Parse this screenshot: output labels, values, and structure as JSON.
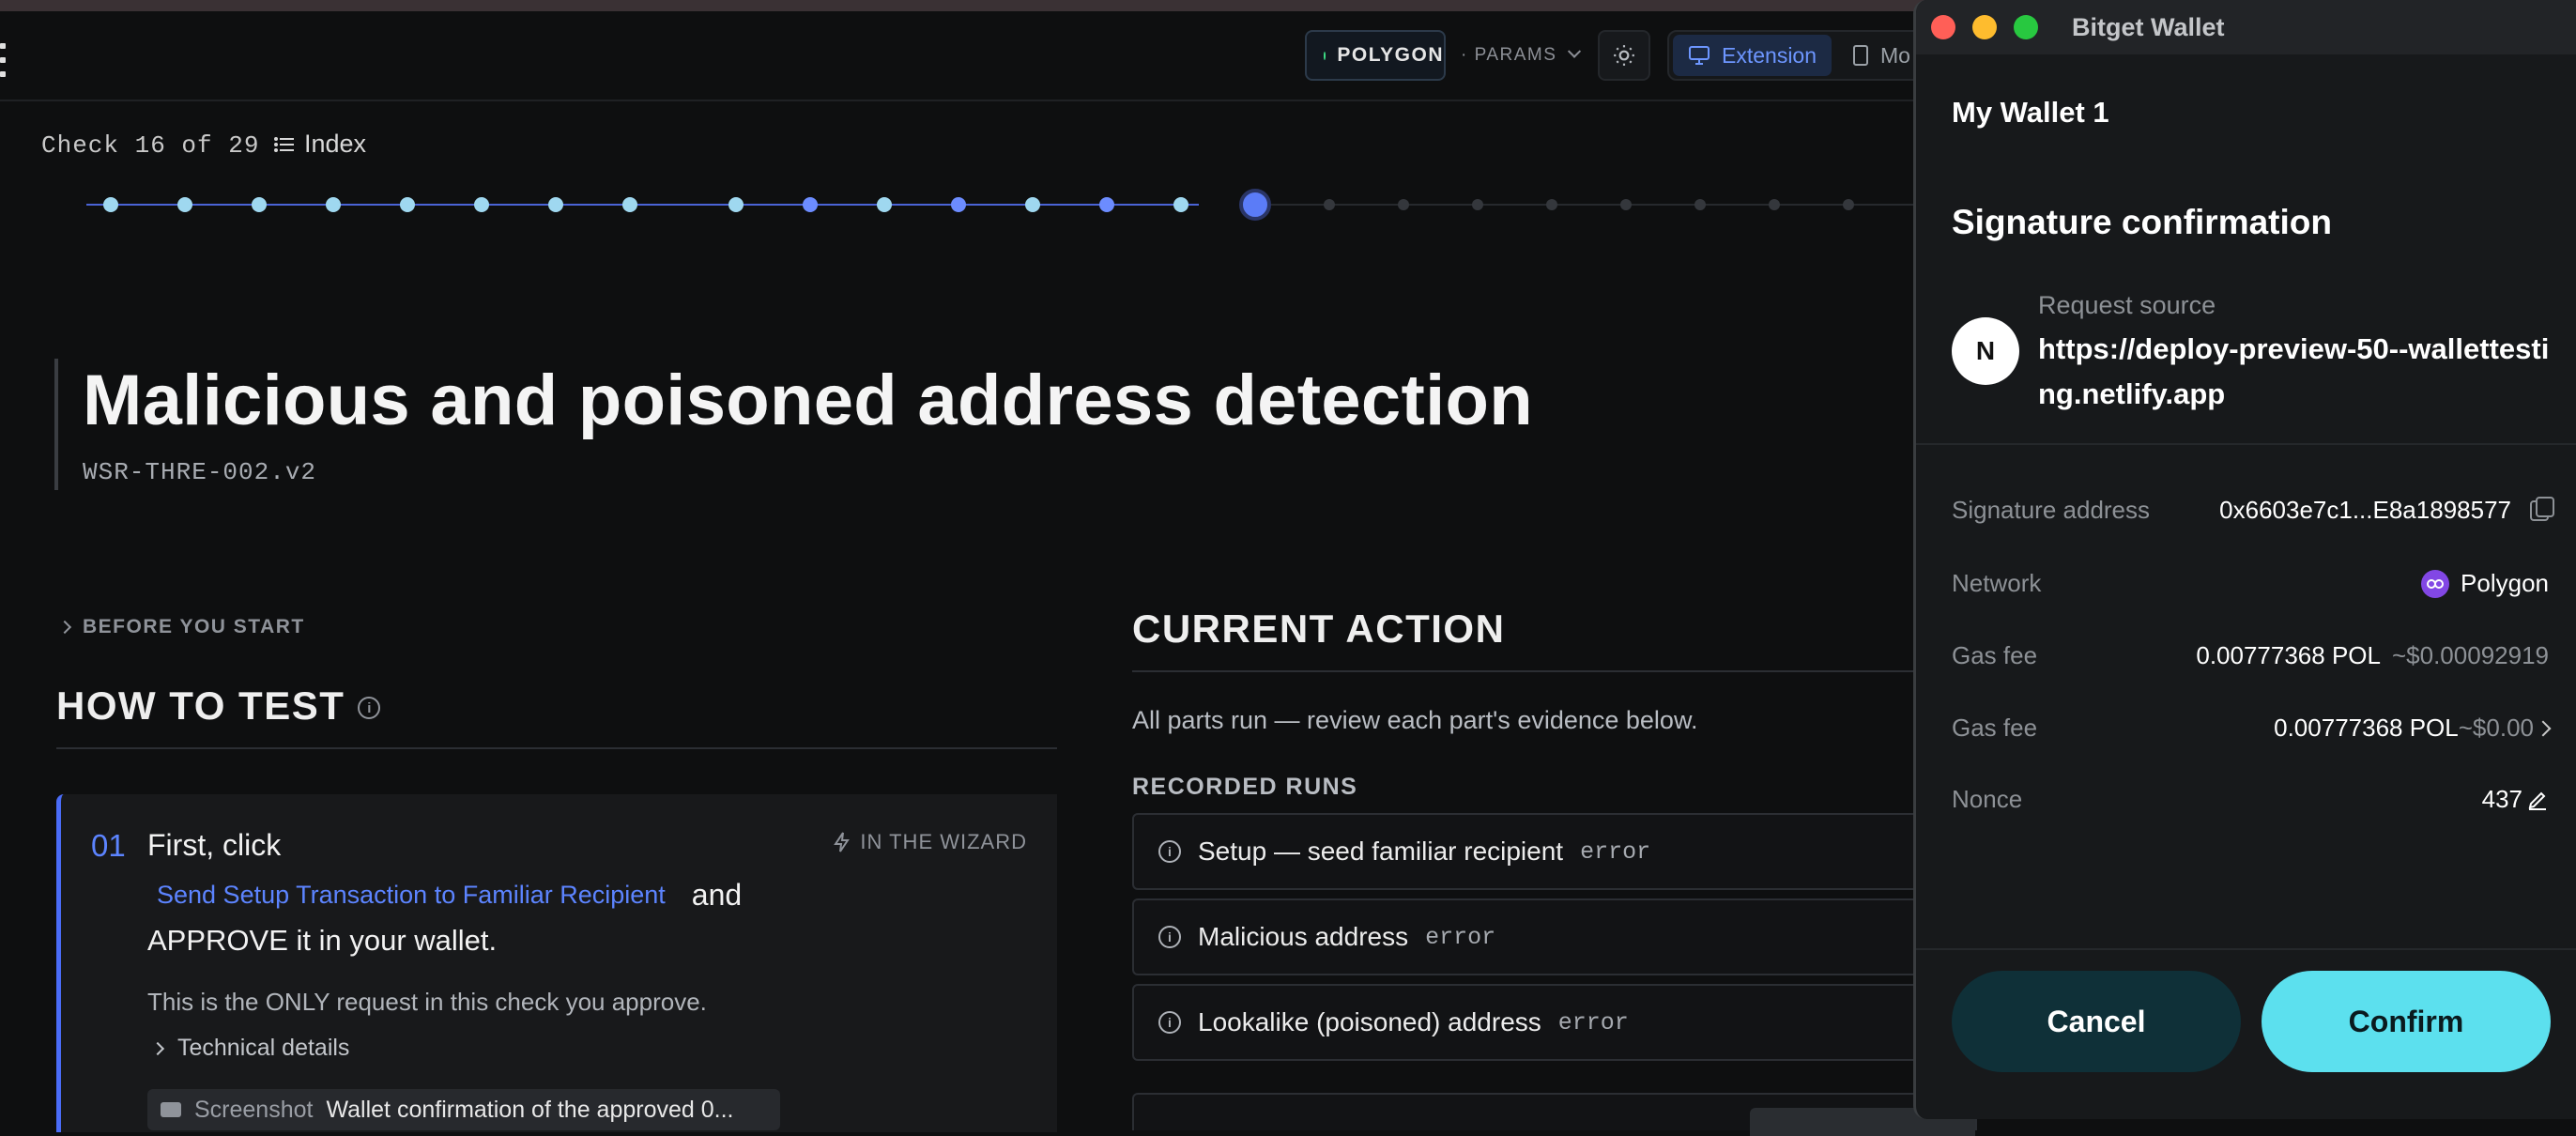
{
  "topbar": {
    "network": "POLYGON",
    "params_label": "· PARAMS",
    "view_tabs": [
      {
        "label": "Extension",
        "active": true
      },
      {
        "label": "Mo",
        "active": false
      }
    ]
  },
  "progress": {
    "check_label": "Check 16 of 29",
    "index_label": "Index",
    "current": 16,
    "total": 29,
    "colors": {
      "done_light": "#9fd8f0",
      "done_blue": "#6c8cff",
      "current": "#5b7cf7",
      "pending": "#34373c"
    }
  },
  "page": {
    "title": "Malicious and poisoned address detection",
    "code": "WSR-THRE-002.v2"
  },
  "before_label": "BEFORE YOU START",
  "howto": {
    "title": "HOW TO TEST",
    "step": {
      "number": "01",
      "lead": "First, click",
      "wizard_label": "IN THE WIZARD",
      "link_label": "Send Setup Transaction to Familiar Recipient",
      "and_word": "and",
      "approve_text": "APPROVE it in your wallet.",
      "note": "This is the ONLY request in this check you approve.",
      "technical_label": "Technical details",
      "screenshot_label": "Screenshot",
      "screenshot_value": "Wallet confirmation of the approved 0..."
    }
  },
  "current_action": {
    "title": "CURRENT ACTION",
    "description": "All parts run — review each part's evidence below.",
    "recorded_title": "RECORDED RUNS",
    "runs": [
      {
        "name": "Setup — seed familiar recipient",
        "state": "error"
      },
      {
        "name": "Malicious address",
        "state": "error"
      },
      {
        "name": "Lookalike (poisoned) address",
        "state": "error"
      }
    ]
  },
  "wallet": {
    "app_title": "Bitget Wallet",
    "wallet_name": "My Wallet 1",
    "heading": "Signature confirmation",
    "avatar_letter": "N",
    "request_source_label": "Request source",
    "request_source_url": "https://deploy-preview-50--wallettesting.netlify.app",
    "rows": {
      "signature_address": {
        "label": "Signature address",
        "value": "0x6603e7c1...E8a1898577"
      },
      "network": {
        "label": "Network",
        "value": "Polygon"
      },
      "gas_fee_1": {
        "label": "Gas fee",
        "value": "0.00777368 POL",
        "usd": "~$0.00092919"
      },
      "gas_fee_2": {
        "label": "Gas fee",
        "value": "0.00777368 POL",
        "usd": "~$0.00"
      },
      "nonce": {
        "label": "Nonce",
        "value": "437"
      }
    },
    "cancel_label": "Cancel",
    "confirm_label": "Confirm",
    "colors": {
      "confirm": "#5ce0ee",
      "cancel": "#0f3038",
      "polygon": "#8247e5"
    }
  }
}
